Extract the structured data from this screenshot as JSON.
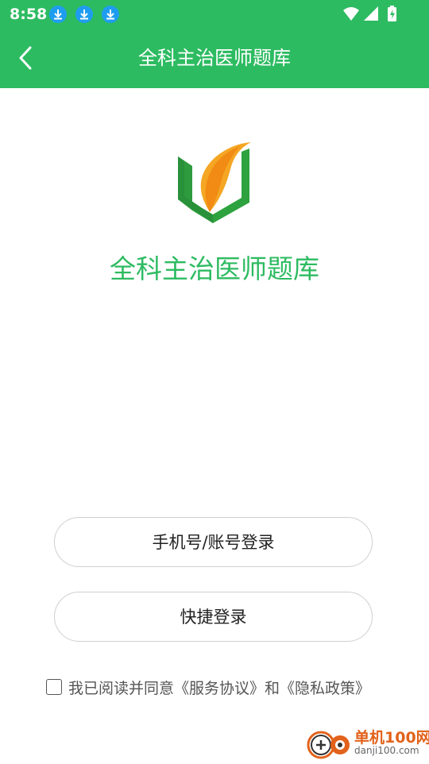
{
  "status_bar": {
    "time": "8:58",
    "notification_icons": [
      "download-icon",
      "download-icon",
      "download-icon"
    ],
    "right_icons": [
      "wifi-icon",
      "signal-icon",
      "battery-charging-icon"
    ]
  },
  "app_bar": {
    "title": "全科主治医师题库",
    "back_icon": "chevron-left-icon"
  },
  "hero": {
    "app_name": "全科主治医师题库",
    "logo_icon": "book-leaf-logo-icon"
  },
  "buttons": {
    "phone_login": "手机号/账号登录",
    "quick_login": "快捷登录"
  },
  "agreement": {
    "checked": false,
    "prefix": "我已阅读并同意",
    "service_link": "《服务协议》",
    "and": "和",
    "privacy_link": "《隐私政策》"
  },
  "watermark": {
    "title": "单机100网",
    "url": "danji100.com"
  },
  "colors": {
    "brand_green": "#2dbb61",
    "logo_orange": "#f5a623",
    "download_blue": "#1e9df0",
    "watermark_orange": "#e2621b"
  }
}
